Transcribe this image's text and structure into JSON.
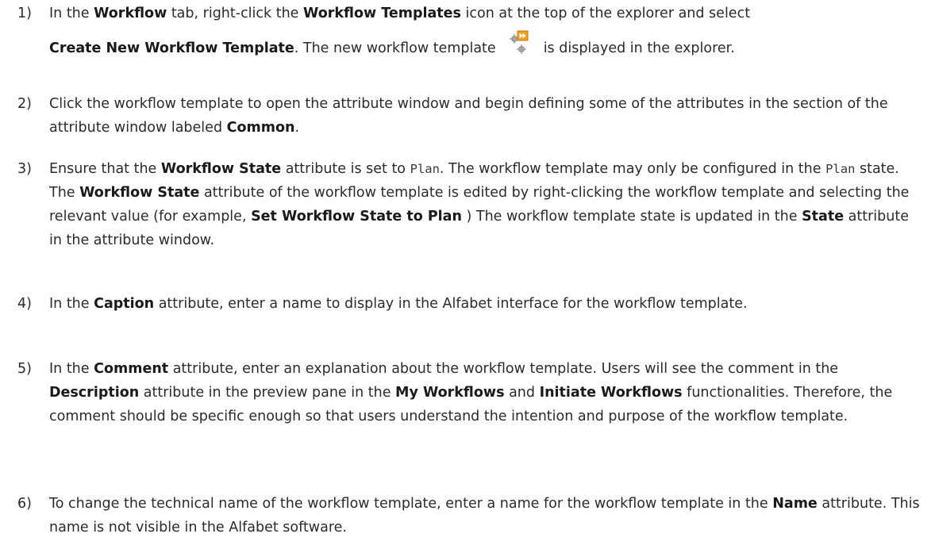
{
  "steps": [
    {
      "number": "1)",
      "line1": {
        "t1": "In the ",
        "b1": "Workflow",
        "t2": " tab, right-click the ",
        "b2": "Workflow Templates",
        "t3": " icon at the top of the explorer and select"
      },
      "line2": {
        "b1": "Create New Workflow Template",
        "t1": ". The new workflow template",
        "t2": "is displayed in the explorer."
      },
      "icon": "workflow-template-icon"
    },
    {
      "number": "2)",
      "t1": "Click the workflow template to open the attribute window and begin defining some of the attributes in the section of the attribute window labeled ",
      "b1": "Common",
      "t2": "."
    },
    {
      "number": "3)",
      "t1": "Ensure that the ",
      "b1": "Workflow State",
      "t2": " attribute is set to ",
      "m1": "Plan",
      "t3": ". The workflow template may only be configured in the ",
      "m2": "Plan",
      "t4": " state. The ",
      "b2": "Workflow State",
      "t5": " attribute of the workflow template is edited by right-clicking the workflow template and selecting the relevant value (for example, ",
      "b3": "Set Workflow State to Plan",
      "t6": " ) The workflow template state is updated in the ",
      "b4": "State",
      "t7": " attribute in the attribute window."
    },
    {
      "number": "4)",
      "t1": "In the ",
      "b1": "Caption",
      "t2": " attribute, enter a name to display in the Alfabet interface for the workflow template."
    },
    {
      "number": "5)",
      "t1": "In the ",
      "b1": "Comment",
      "t2": " attribute, enter an explanation about the workflow template. Users will see the comment in the ",
      "b2": "Description",
      "t3": " attribute in the preview pane in the ",
      "b3": "My Workflows",
      "t4": " and ",
      "b4": "Initiate Workflows",
      "t5": " functionalities. Therefore, the comment should be specific enough so that users understand the intention and purpose of the workflow template."
    },
    {
      "number": "6)",
      "t1": "To change the technical name of the workflow template, enter a name for the workflow template in the ",
      "b1": "Name",
      "t2": " attribute. This name is not visible in the Alfabet software."
    }
  ],
  "colors": {
    "text": "#2b2b2b",
    "icon_orange": "#f0a020",
    "icon_gray": "#8a8a8a"
  }
}
